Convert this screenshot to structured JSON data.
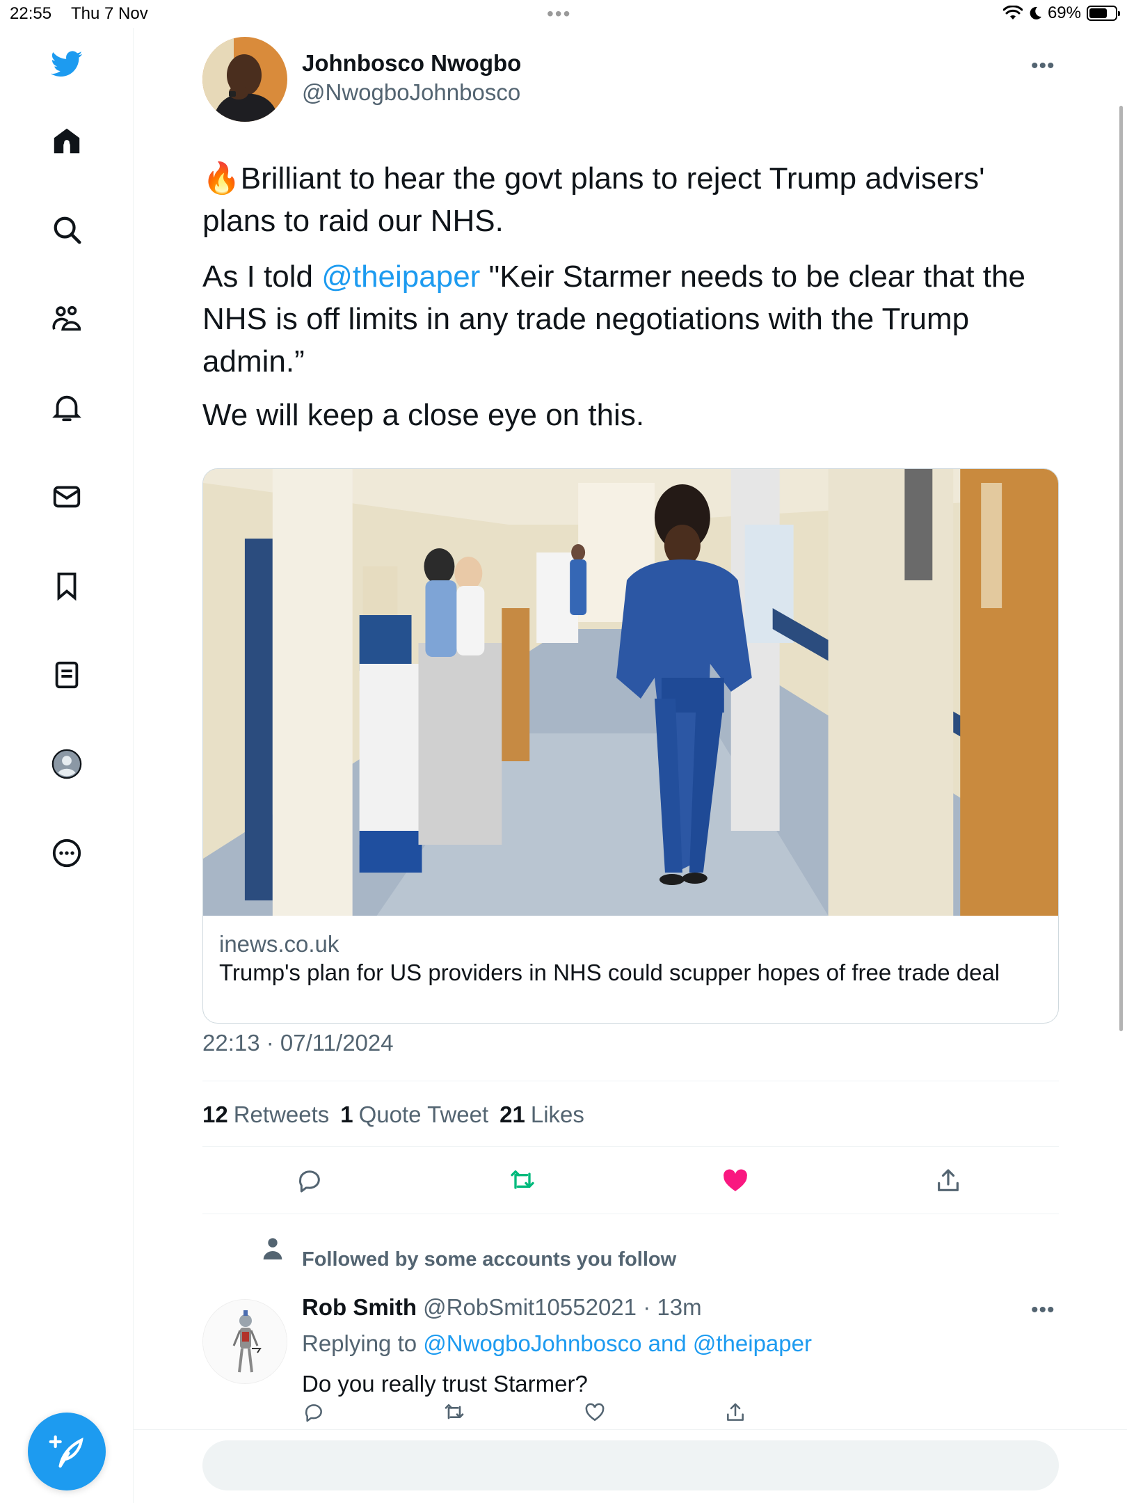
{
  "status_bar": {
    "time": "22:55",
    "date": "Thu 7 Nov",
    "battery": "69%",
    "battery_level": 0.69
  },
  "sidebar": {
    "items": [
      {
        "icon": "twitter-bird-icon"
      },
      {
        "icon": "home-icon"
      },
      {
        "icon": "search-icon"
      },
      {
        "icon": "communities-icon"
      },
      {
        "icon": "notifications-bell-icon"
      },
      {
        "icon": "messages-envelope-icon"
      },
      {
        "icon": "bookmark-icon"
      },
      {
        "icon": "lists-icon"
      },
      {
        "icon": "profile-avatar-icon"
      },
      {
        "icon": "more-circle-icon"
      }
    ],
    "compose_icon": "compose-feather-icon"
  },
  "tweet": {
    "author_name": "Johnbosco Nwogbo",
    "author_handle": "@NwogboJohnbosco",
    "para1": "🔥Brilliant to hear the govt plans to reject Trump advisers' plans to raid our NHS.",
    "para2_prefix": "As I told ",
    "para2_mention": "@theipaper",
    "para2_rest": " \"Keir Starmer needs to be clear that the NHS is off limits in any trade negotiations with the Trump admin.”",
    "para3": "We will keep a close eye on this.",
    "card": {
      "domain": "inews.co.uk",
      "title": "Trump's plan for US providers in NHS could scupper hopes of free trade deal"
    },
    "timestamp": "22:13 · 07/11/2024",
    "stats": {
      "retweets_count": "12",
      "retweets_label": "Retweets",
      "quotes_count": "1",
      "quotes_label": "Quote Tweet",
      "likes_count": "21",
      "likes_label": "Likes"
    }
  },
  "reply": {
    "context": "Followed by some accounts you follow",
    "name": "Rob Smith",
    "handle": "@RobSmit10552021",
    "time": "· 13m",
    "replying_label": "Replying to",
    "replying_to": "@NwogboJohnbosco and @theipaper",
    "text": "Do you really trust Starmer?"
  },
  "colors": {
    "accent": "#1d9bf0",
    "retweet_green": "#00ba7c",
    "like_pink": "#f91880",
    "muted": "#536471"
  }
}
